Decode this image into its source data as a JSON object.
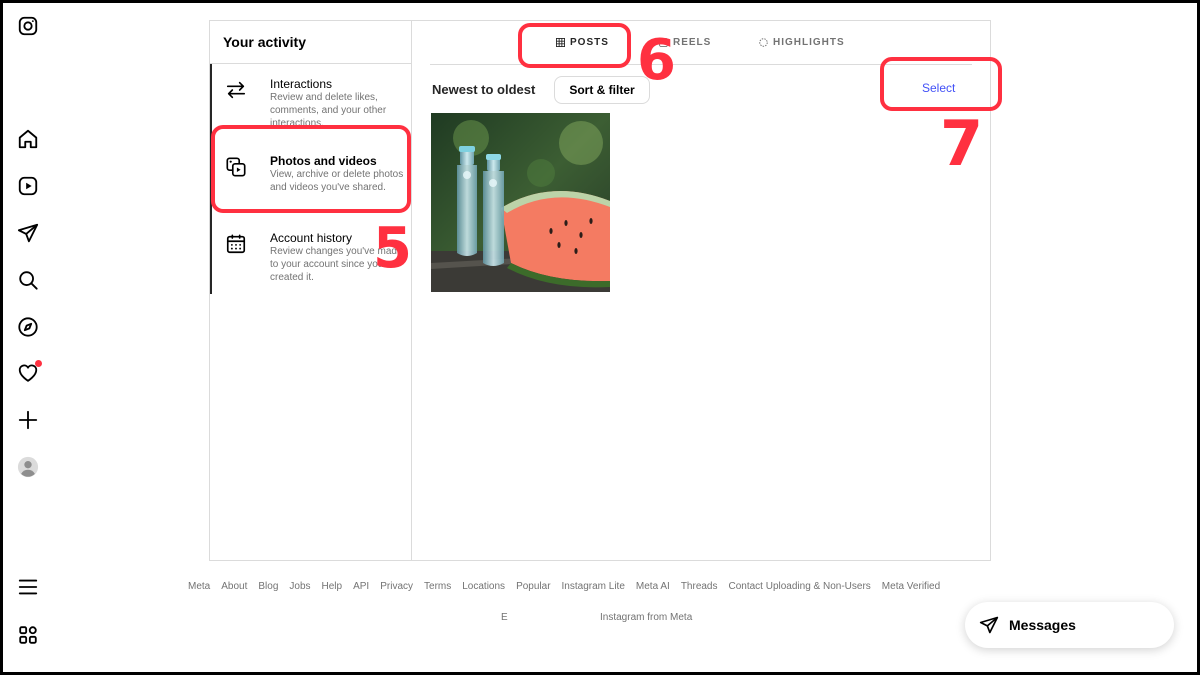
{
  "nav": {
    "icons": [
      "instagram-logo-icon",
      "home-icon",
      "reels-icon",
      "direct-icon",
      "search-icon",
      "explore-icon",
      "heart-icon",
      "create-icon",
      "profile-icon",
      "menu-icon",
      "apps-icon"
    ]
  },
  "activity": {
    "title": "Your activity",
    "items": [
      {
        "label": "Interactions",
        "description": "Review and delete likes, comments, and your other interactions.",
        "icon": "arrows-swap-icon"
      },
      {
        "label": "Photos and videos",
        "description": "View, archive or delete photos and videos you've shared.",
        "icon": "photos-icon"
      },
      {
        "label": "Account history",
        "description": "Review changes you've made to your account since you created it.",
        "icon": "calendar-icon"
      }
    ]
  },
  "tabs": [
    {
      "label": "POSTS",
      "icon": "grid-icon",
      "active": true
    },
    {
      "label": "REELS",
      "icon": "reels-icon",
      "active": false
    },
    {
      "label": "HIGHLIGHTS",
      "icon": "circle-dashed-icon",
      "active": false
    }
  ],
  "toolbar": {
    "sort_label": "Newest to oldest",
    "sort_button": "Sort & filter",
    "select_link": "Select"
  },
  "posts": [
    {
      "subject": "glass bottles and watermelon slice"
    }
  ],
  "annotations": {
    "step5": "5",
    "step6": "6",
    "step7": "7",
    "color": "#ff3040"
  },
  "footer": {
    "links": [
      "Meta",
      "About",
      "Blog",
      "Jobs",
      "Help",
      "API",
      "Privacy",
      "Terms",
      "Locations",
      "Popular",
      "Instagram Lite",
      "Meta AI",
      "Threads",
      "Contact Uploading & Non-Users",
      "Meta Verified"
    ],
    "language": "E",
    "copyright": "Instagram from Meta"
  },
  "messages": {
    "label": "Messages"
  },
  "colors": {
    "accent_link": "#4150f7",
    "notification": "#ff3040",
    "border": "#dbdbdb",
    "muted_text": "#737373"
  }
}
